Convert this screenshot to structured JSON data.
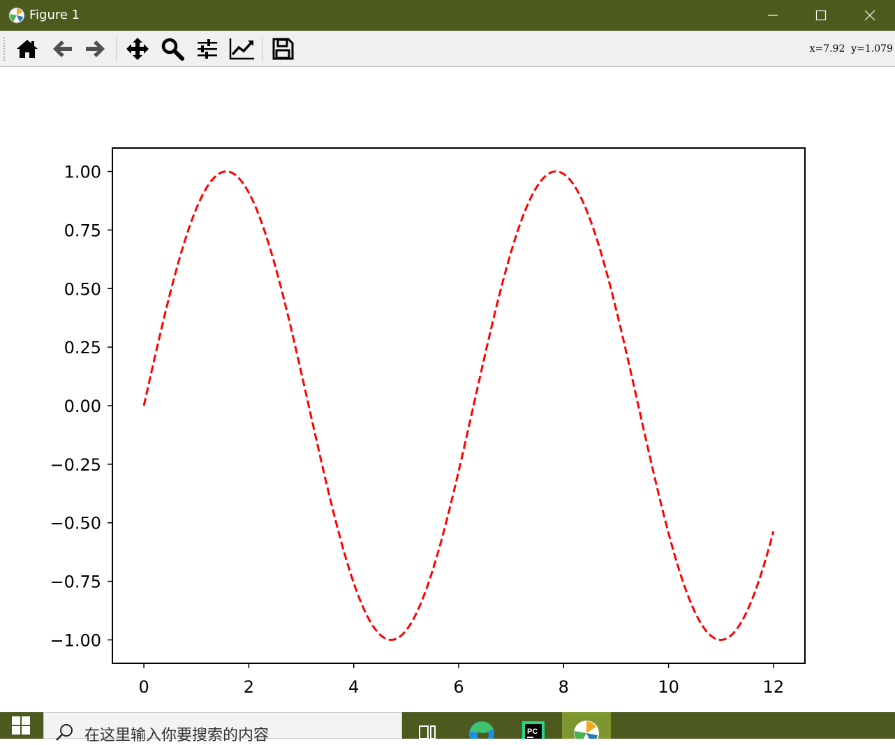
{
  "window": {
    "title": "Figure 1"
  },
  "toolbar": {
    "buttons": [
      {
        "name": "home",
        "icon": "home-icon"
      },
      {
        "name": "back",
        "icon": "arrow-left-icon"
      },
      {
        "name": "forward",
        "icon": "arrow-right-icon"
      },
      {
        "name": "pan",
        "icon": "move-icon"
      },
      {
        "name": "zoom",
        "icon": "search-icon"
      },
      {
        "name": "configure-subplots",
        "icon": "sliders-icon"
      },
      {
        "name": "edit-axis",
        "icon": "line-chart-icon"
      },
      {
        "name": "save",
        "icon": "floppy-disk-icon"
      }
    ],
    "coordinates": "x=7.92  y=1.079"
  },
  "colors": {
    "titlebar": "#4d5a1e",
    "taskbar": "#4c5a1f",
    "line": "#ff0000"
  },
  "chart_data": {
    "type": "line",
    "function": "sin(x)",
    "x_range": [
      0,
      12
    ],
    "xlim": [
      -0.6,
      12.6
    ],
    "ylim": [
      -1.1,
      1.1
    ],
    "xticks": [
      "0",
      "2",
      "4",
      "6",
      "8",
      "10",
      "12"
    ],
    "yticks": [
      "1.00",
      "0.75",
      "0.50",
      "0.25",
      "0.00",
      "−0.25",
      "−0.50",
      "−0.75",
      "−1.00"
    ],
    "series": [
      {
        "line_style": "dashed",
        "color": "#ff0000",
        "x": [
          0,
          0.5,
          1,
          1.5,
          2,
          2.5,
          3,
          3.5,
          4,
          4.5,
          5,
          5.5,
          6,
          6.5,
          7,
          7.5,
          8,
          8.5,
          9,
          9.5,
          10,
          10.5,
          11,
          11.5,
          12
        ],
        "y": [
          0,
          0.479,
          0.841,
          0.997,
          0.909,
          0.598,
          0.141,
          -0.351,
          -0.757,
          -0.978,
          -0.959,
          -0.706,
          -0.279,
          0.215,
          0.657,
          0.938,
          0.989,
          0.798,
          0.412,
          -0.075,
          -0.544,
          -0.88,
          -1.0,
          -0.875,
          -0.537
        ]
      }
    ],
    "title": "",
    "xlabel": "",
    "ylabel": "",
    "grid": false
  },
  "taskbar": {
    "search_placeholder": "在这里输入你要搜索的内容",
    "apps": [
      "task-view",
      "edge",
      "pycharm",
      "matplotlib-figure"
    ]
  }
}
